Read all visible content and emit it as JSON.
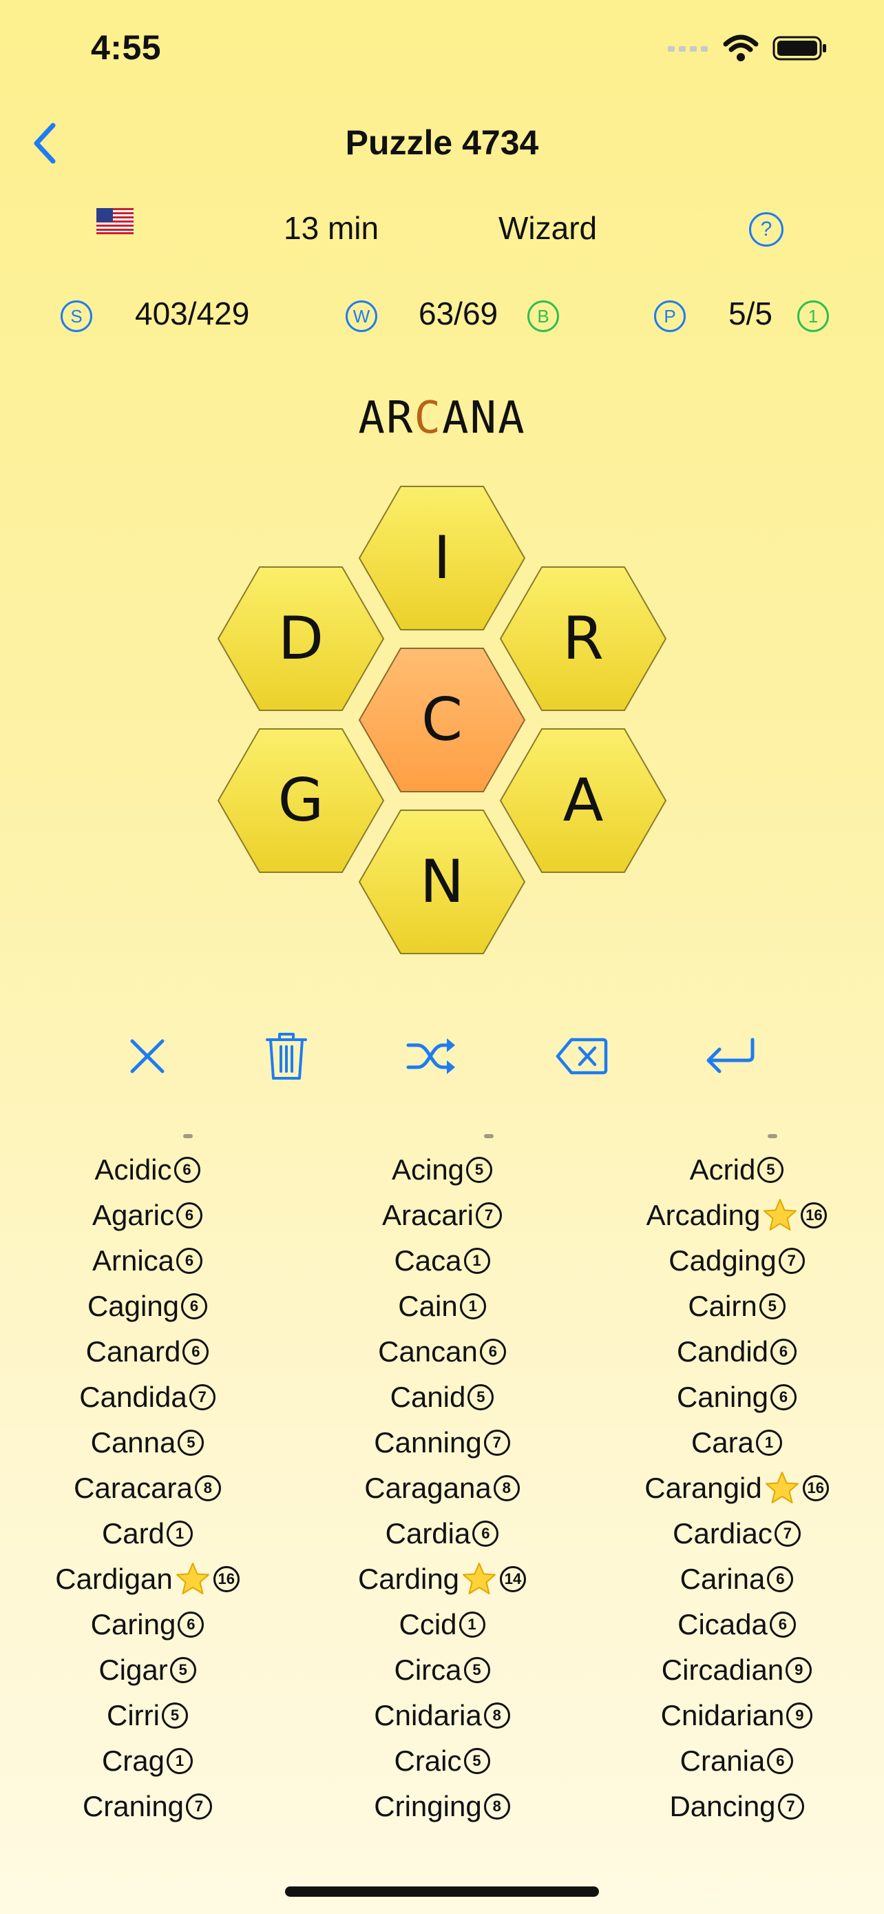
{
  "status_bar": {
    "time": "4:55"
  },
  "nav": {
    "title": "Puzzle 4734",
    "back_icon": "chevron-left-icon"
  },
  "info": {
    "flag_icon": "us-flag-icon",
    "time": "13 min",
    "rank": "Wizard"
  },
  "stats": {
    "score_badge": "S",
    "score": "403/429",
    "words_badge": "W",
    "words": "63/69",
    "bingo_badge": "B",
    "pangram_badge": "P",
    "pangrams": "5/5",
    "perfect_badge": "1"
  },
  "current_word": {
    "before": "AR",
    "center": "C",
    "after": "ANA"
  },
  "hive": {
    "center": "C",
    "top": "I",
    "upper_left": "D",
    "upper_right": "R",
    "lower_left": "G",
    "lower_right": "A",
    "bottom": "N"
  },
  "actions": [
    "clear-icon",
    "trash-icon",
    "shuffle-icon",
    "backspace-icon",
    "enter-icon"
  ],
  "colors": {
    "accent": "#1e7cf2",
    "green": "#2fbf4a",
    "hex_outer": "#f3e02c",
    "hex_center": "#ffb060",
    "center_letter": "#b5641a"
  },
  "word_columns": [
    [
      {
        "w": "Acidic",
        "n": "6"
      },
      {
        "w": "Agaric",
        "n": "6"
      },
      {
        "w": "Arnica",
        "n": "6"
      },
      {
        "w": "Caging",
        "n": "6"
      },
      {
        "w": "Canard",
        "n": "6"
      },
      {
        "w": "Candida",
        "n": "7"
      },
      {
        "w": "Canna",
        "n": "5"
      },
      {
        "w": "Caracara",
        "n": "8"
      },
      {
        "w": "Card",
        "n": "1"
      },
      {
        "w": "Cardigan",
        "n": "16",
        "star": true
      },
      {
        "w": "Caring",
        "n": "6"
      },
      {
        "w": "Cigar",
        "n": "5"
      },
      {
        "w": "Cirri",
        "n": "5"
      },
      {
        "w": "Crag",
        "n": "1"
      },
      {
        "w": "Craning",
        "n": "7"
      }
    ],
    [
      {
        "w": "Acing",
        "n": "5"
      },
      {
        "w": "Aracari",
        "n": "7"
      },
      {
        "w": "Caca",
        "n": "1"
      },
      {
        "w": "Cain",
        "n": "1"
      },
      {
        "w": "Cancan",
        "n": "6"
      },
      {
        "w": "Canid",
        "n": "5"
      },
      {
        "w": "Canning",
        "n": "7"
      },
      {
        "w": "Caragana",
        "n": "8"
      },
      {
        "w": "Cardia",
        "n": "6"
      },
      {
        "w": "Carding",
        "n": "14",
        "star": true
      },
      {
        "w": "Ccid",
        "n": "1"
      },
      {
        "w": "Circa",
        "n": "5"
      },
      {
        "w": "Cnidaria",
        "n": "8"
      },
      {
        "w": "Craic",
        "n": "5"
      },
      {
        "w": "Cringing",
        "n": "8"
      }
    ],
    [
      {
        "w": "Acrid",
        "n": "5"
      },
      {
        "w": "Arcading",
        "n": "16",
        "star": true
      },
      {
        "w": "Cadging",
        "n": "7"
      },
      {
        "w": "Cairn",
        "n": "5"
      },
      {
        "w": "Candid",
        "n": "6"
      },
      {
        "w": "Caning",
        "n": "6"
      },
      {
        "w": "Cara",
        "n": "1"
      },
      {
        "w": "Carangid",
        "n": "16",
        "star": true
      },
      {
        "w": "Cardiac",
        "n": "7"
      },
      {
        "w": "Carina",
        "n": "6"
      },
      {
        "w": "Cicada",
        "n": "6"
      },
      {
        "w": "Circadian",
        "n": "9"
      },
      {
        "w": "Cnidarian",
        "n": "9"
      },
      {
        "w": "Crania",
        "n": "6"
      },
      {
        "w": "Dancing",
        "n": "7"
      }
    ]
  ]
}
